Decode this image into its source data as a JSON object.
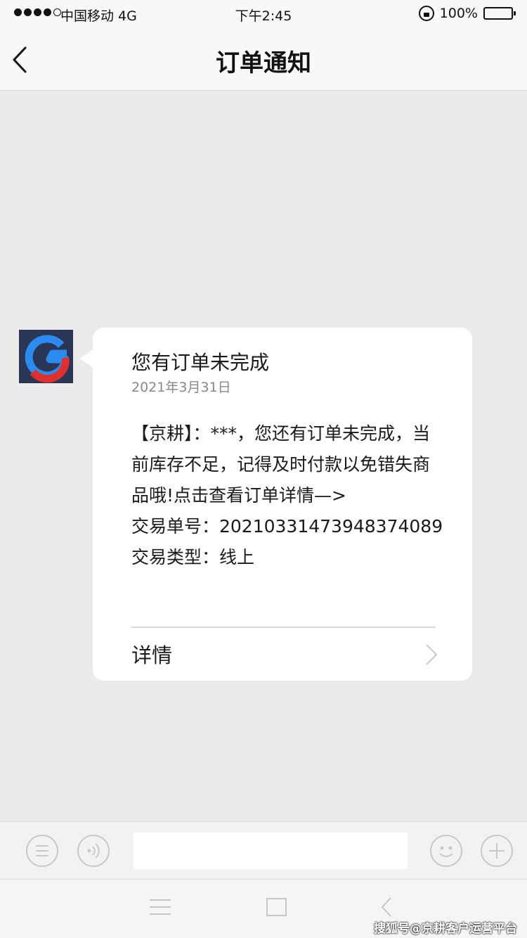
{
  "status_bar": {
    "carrier": "中国移动 4G",
    "time": "下午2:45",
    "battery": "100%",
    "signal_bars": 4
  },
  "nav": {
    "title": "订单通知",
    "back_icon": "chevron-left-icon"
  },
  "message": {
    "avatar_icon": "g-logo",
    "title": "您有订单未完成",
    "date": "2021年3月31日",
    "body_lines": [
      "【京耕】：***，您还有订单未完成，当",
      "前库存不足，记得及时付款以免错失商",
      "品哦!点击查看订单详情—>",
      "交易单号：20210331473948374089",
      "交易类型：线上"
    ],
    "detail_label": "详情"
  },
  "input_bar": {
    "menu_icon": "menu-circle-icon",
    "voice_icon": "voice-icon",
    "input_value": "",
    "emoji_icon": "emoji-icon",
    "add_icon": "plus-icon"
  },
  "bottom_nav": {
    "menu_icon": "hamburger-icon",
    "home_icon": "square-icon",
    "back_icon": "back-triangle-icon"
  },
  "watermark": "搜狐号@京耕客户运营平台",
  "colors": {
    "background": "#ebebeb",
    "bubble": "#ffffff",
    "logo_blue": "#2a8cf0",
    "logo_red": "#e0302d",
    "logo_bg": "#2b3556"
  }
}
